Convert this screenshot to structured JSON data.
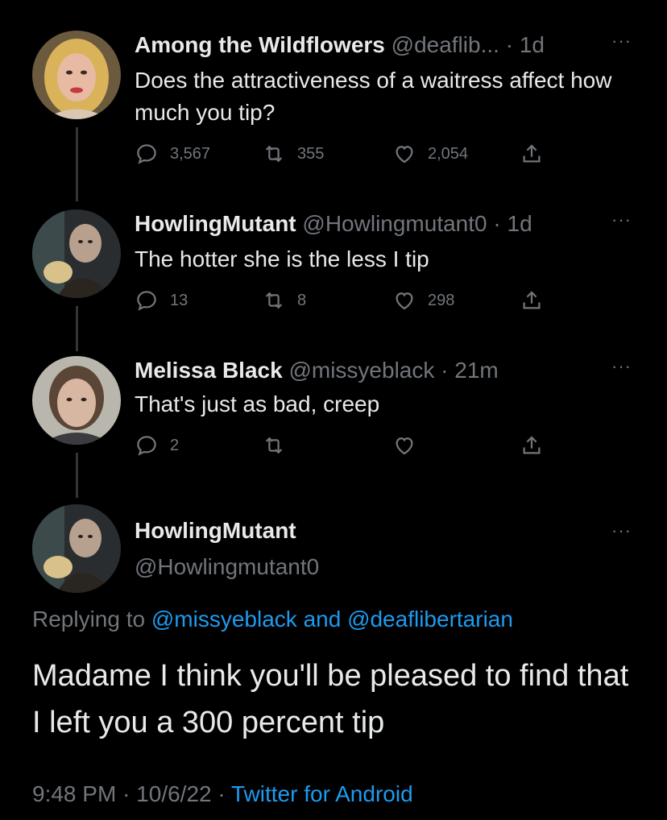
{
  "tweets": [
    {
      "name": "Among the Wildflowers",
      "handle": "@deaflib...",
      "time": "1d",
      "text": "Does the attractiveness of a waitress affect how much you tip?",
      "replies": "3,567",
      "retweets": "355",
      "likes": "2,054"
    },
    {
      "name": "HowlingMutant",
      "handle": "@Howlingmutant0",
      "time": "1d",
      "text": "The hotter she is the less I tip",
      "replies": "13",
      "retweets": "8",
      "likes": "298"
    },
    {
      "name": "Melissa Black",
      "handle": "@missyeblack",
      "time": "21m",
      "text": "That's just as bad, creep",
      "replies": "2",
      "retweets": "",
      "likes": ""
    }
  ],
  "main": {
    "name": "HowlingMutant",
    "handle": "@Howlingmutant0",
    "replying_prefix": "Replying to",
    "replying_user1": "@missyeblack",
    "replying_and": "and",
    "replying_user2": "@deaflibertarian",
    "text": "Madame I think you'll be pleased to find that I left you a 300 percent tip",
    "time": "9:48 PM",
    "date": "10/6/22",
    "source": "Twitter for Android"
  },
  "separator": "·",
  "more_label": "···",
  "colors": {
    "background": "#000000",
    "text": "#e7e9ea",
    "secondary": "#71767b",
    "link": "#1d9bf0"
  },
  "icons": [
    "reply-icon",
    "retweet-icon",
    "like-icon",
    "share-icon",
    "more-icon"
  ]
}
